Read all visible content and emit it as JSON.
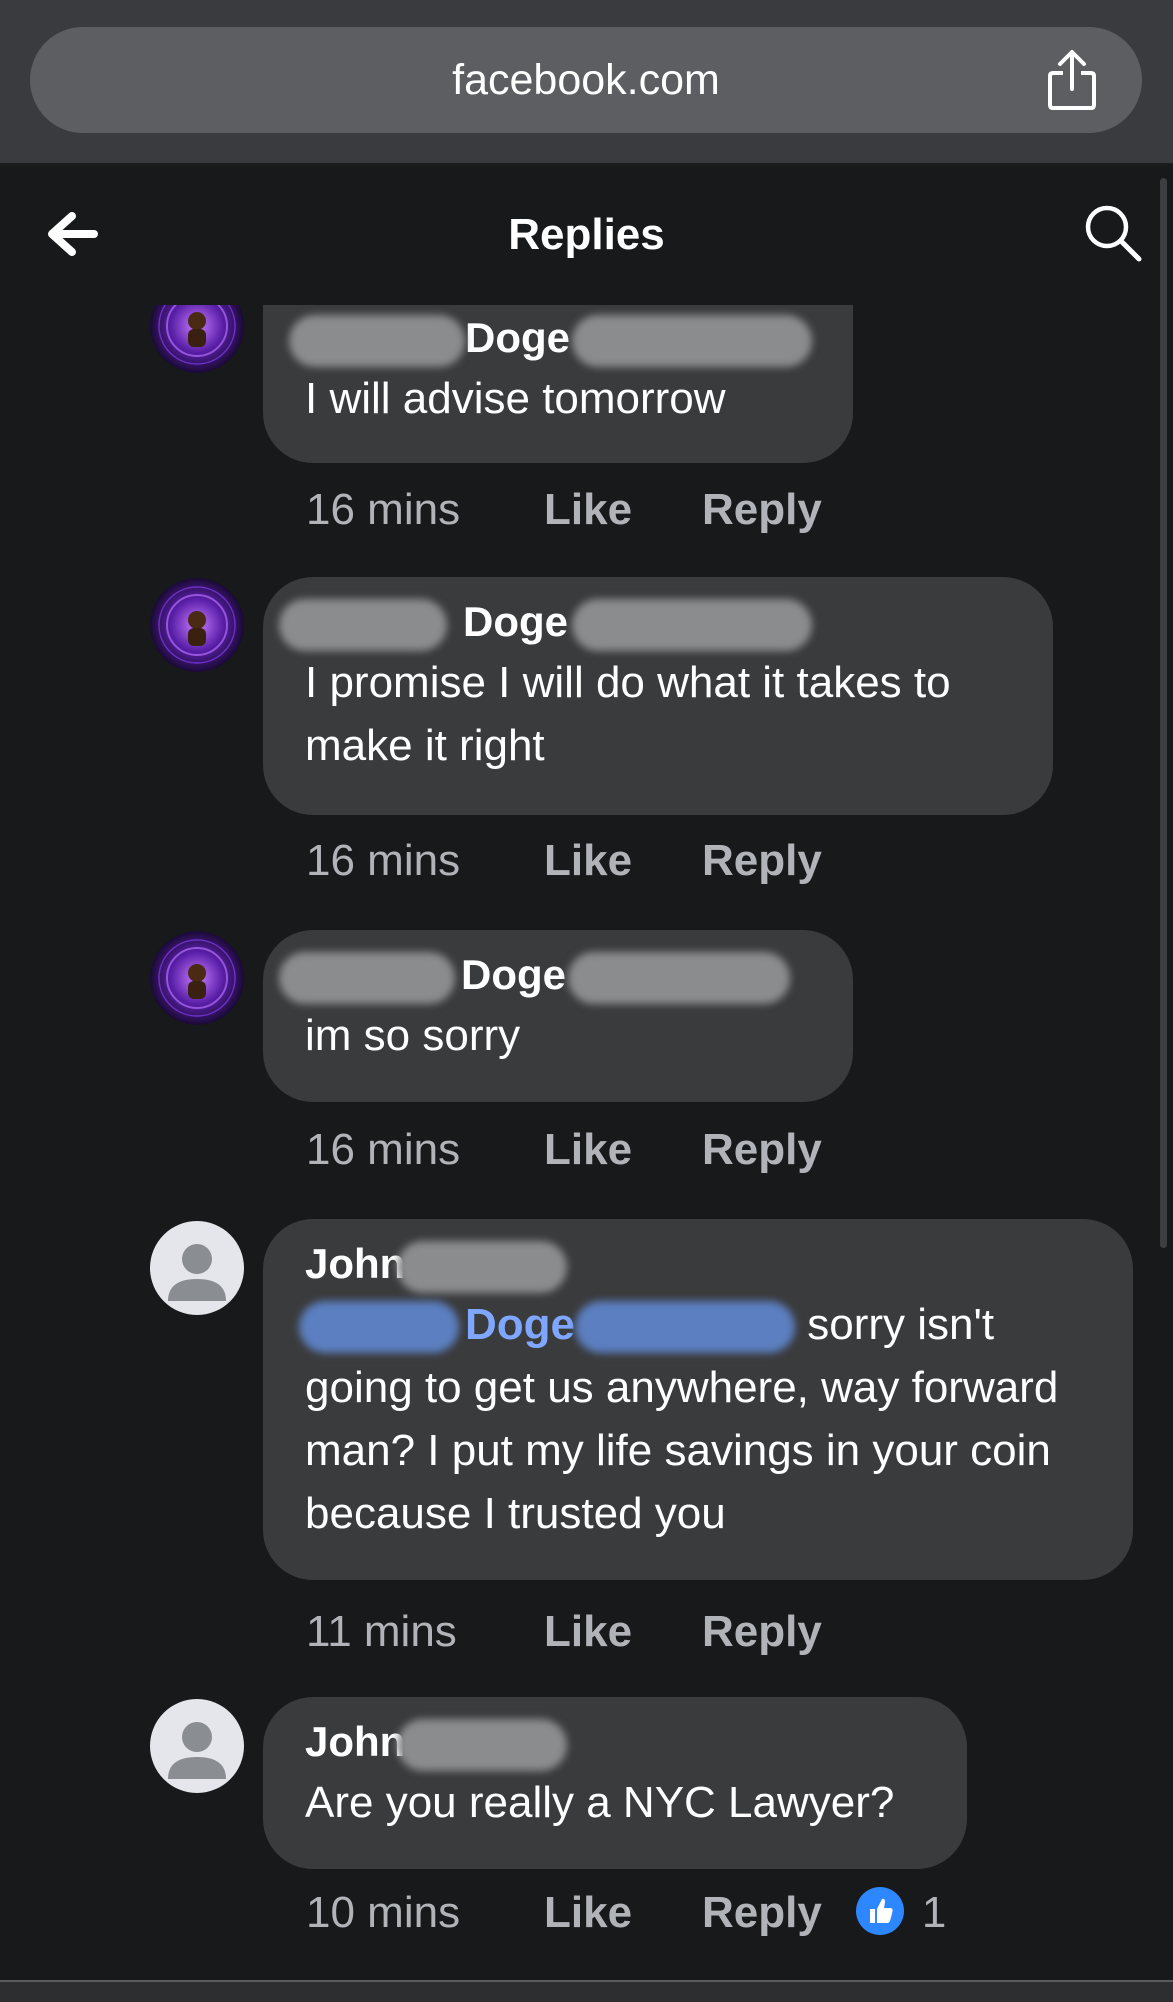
{
  "browser": {
    "url": "facebook.com",
    "share_icon": "share-icon"
  },
  "header": {
    "title": "Replies",
    "back_icon": "arrow-left-icon",
    "search_icon": "search-icon"
  },
  "comments": [
    {
      "author_visible": "Doge",
      "text": "I will advise tomorrow",
      "time": "16 mins",
      "like": "Like",
      "reply": "Reply",
      "avatar": "purple-logo-avatar"
    },
    {
      "author_visible": "Doge",
      "text": "I promise I will do what it takes to make it right",
      "time": "16 mins",
      "like": "Like",
      "reply": "Reply",
      "avatar": "purple-logo-avatar"
    },
    {
      "author_visible": "Doge",
      "text": "im so sorry",
      "time": "16 mins",
      "like": "Like",
      "reply": "Reply",
      "avatar": "purple-logo-avatar"
    },
    {
      "author_visible": "John",
      "mention_visible": "Doge",
      "text": "sorry isn't going to get us anywhere, way forward man? I put my life savings in your coin because I trusted you",
      "time": "11 mins",
      "like": "Like",
      "reply": "Reply",
      "avatar": "default-profile-avatar"
    },
    {
      "author_visible": "John",
      "text": "Are you really a NYC Lawyer?",
      "time": "10 mins",
      "like": "Like",
      "reply": "Reply",
      "reaction_count": "1",
      "avatar": "default-profile-avatar"
    }
  ],
  "colors": {
    "background": "#18191a",
    "bubble": "#3a3b3c",
    "mention": "#7fa7ff",
    "reaction": "#2d88ff"
  }
}
